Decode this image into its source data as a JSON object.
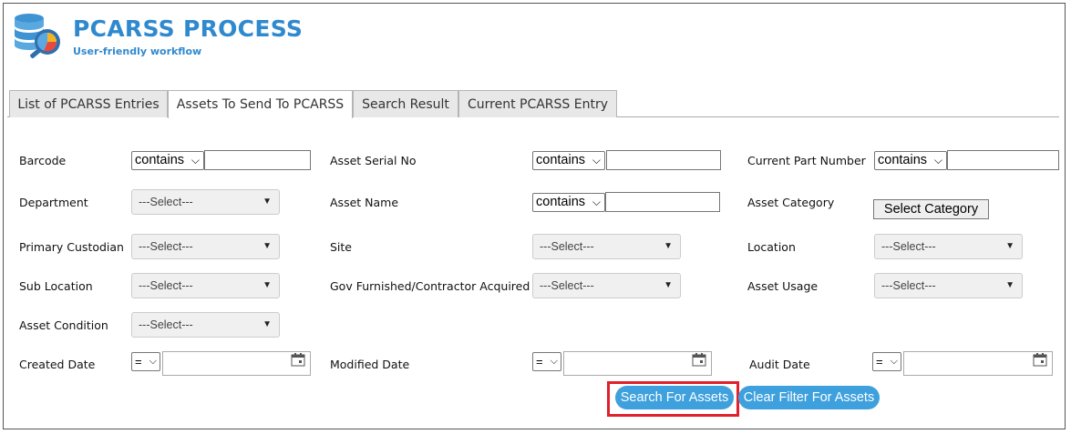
{
  "app": {
    "title": "PCARSS PROCESS",
    "subtitle": "User-friendly workflow"
  },
  "tabs": [
    {
      "label": "List of PCARSS Entries"
    },
    {
      "label": "Assets To Send To PCARSS"
    },
    {
      "label": "Search Result"
    },
    {
      "label": "Current PCARSS Entry"
    }
  ],
  "active_tab": "Assets To Send To PCARSS",
  "filters": {
    "barcode": {
      "label": "Barcode",
      "op": "contains",
      "value": ""
    },
    "asset_serial_no": {
      "label": "Asset Serial No",
      "op": "contains",
      "value": ""
    },
    "current_part_number": {
      "label": "Current Part Number",
      "op": "contains",
      "value": ""
    },
    "department": {
      "label": "Department",
      "value": "---Select---"
    },
    "asset_name": {
      "label": "Asset Name",
      "op": "contains",
      "value": ""
    },
    "asset_category": {
      "label": "Asset Category",
      "button": "Select Category"
    },
    "primary_custodian": {
      "label": "Primary Custodian",
      "value": "---Select---"
    },
    "site": {
      "label": "Site",
      "value": "---Select---"
    },
    "location": {
      "label": "Location",
      "value": "---Select---"
    },
    "sub_location": {
      "label": "Sub Location",
      "value": "---Select---"
    },
    "gov_furnished": {
      "label": "Gov Furnished/Contractor Acquired",
      "value": "---Select---"
    },
    "asset_usage": {
      "label": "Asset Usage",
      "value": "---Select---"
    },
    "asset_condition": {
      "label": "Asset Condition",
      "value": "---Select---"
    },
    "created_date": {
      "label": "Created Date",
      "op": "=",
      "value": ""
    },
    "modified_date": {
      "label": "Modified Date",
      "op": "=",
      "value": ""
    },
    "audit_date": {
      "label": "Audit Date",
      "op": "=",
      "value": ""
    }
  },
  "actions": {
    "search": "Search For Assets",
    "clear": "Clear Filter For Assets"
  },
  "icons": {
    "select_chevron": "▾",
    "dropdown_arrow": "▼",
    "calendar": "calendar-icon",
    "logo": "database-chart-magnifier-logo"
  },
  "colors": {
    "brand": "#2f89cf",
    "button": "#3ea0dd",
    "highlight": "#e0202a"
  }
}
